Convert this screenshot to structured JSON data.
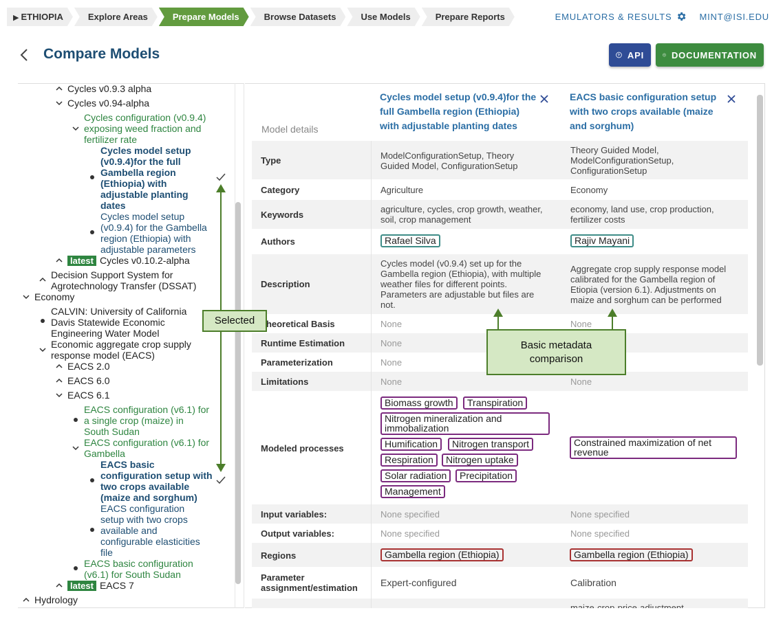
{
  "breadcrumb": {
    "items": [
      {
        "label": "ETHIOPIA",
        "active": false
      },
      {
        "label": "Explore Areas",
        "active": false
      },
      {
        "label": "Prepare Models",
        "active": true
      },
      {
        "label": "Browse Datasets",
        "active": false
      },
      {
        "label": "Use Models",
        "active": false
      },
      {
        "label": "Prepare Reports",
        "active": false
      }
    ]
  },
  "header": {
    "emulators_link": "EMULATORS & RESULTS",
    "user_link": "MINT@ISI.EDU"
  },
  "page": {
    "title": "Compare Models",
    "api_button": "API",
    "docs_button": "DOCUMENTATION"
  },
  "tree": {
    "cycles_093": "Cycles v0.9.3 alpha",
    "cycles_094": "Cycles v0.94-alpha",
    "cycles_cfg": "Cycles configuration (v0.9.4) exposing weed fraction and fertilizer rate",
    "cycles_setup_sel_l1": "Cycles model setup",
    "cycles_setup_sel_l2": "(v0.9.4)for the full",
    "cycles_setup_sel_l3": "Gambella region",
    "cycles_setup_sel_l4": "(Ethiopia) with",
    "cycles_setup_sel_l5": "adjustable planting",
    "cycles_setup_sel_l6": "dates",
    "cycles_setup2_l1": "Cycles model setup",
    "cycles_setup2_l2": "(v0.9.4) for the Gambella",
    "cycles_setup2_l3": "region (Ethiopia) with",
    "cycles_setup2_l4": "adjustable parameters",
    "latest_badge": "latest",
    "cycles_0102": "Cycles v0.10.2-alpha",
    "dssat_l1": "Decision Support System for",
    "dssat_l2": "Agrotechnology Transfer (DSSAT)",
    "economy": "Economy",
    "calvin_l1": "CALVIN: University of California",
    "calvin_l2": "Davis Statewide Economic",
    "calvin_l3": "Engineering Water Model",
    "eacs_l1": "Economic aggregate crop supply",
    "eacs_l2": "response model (EACS)",
    "eacs20": "EACS 2.0",
    "eacs60": "EACS 6.0",
    "eacs61": "EACS 6.1",
    "eacs_cfg_maize_l1": "EACS configuration (v6.1) for",
    "eacs_cfg_maize_l2": "a single crop (maize) in",
    "eacs_cfg_maize_l3": "South Sudan",
    "eacs_cfg_gam_l1": "EACS configuration (v6.1) for",
    "eacs_cfg_gam_l2": "Gambella",
    "eacs_sel_l1": "EACS basic",
    "eacs_sel_l2": "configuration setup with",
    "eacs_sel_l3": "two crops available",
    "eacs_sel_l4": "(maize and sorghum)",
    "eacs_el_l1": "EACS configuration",
    "eacs_el_l2": "setup with two crops",
    "eacs_el_l3": "available and",
    "eacs_el_l4": "configurable elasticities",
    "eacs_el_l5": "file",
    "eacs_basic_ss_l1": "EACS basic configuration",
    "eacs_basic_ss_l2": "(v6.1) for South Sudan",
    "eacs7": "EACS 7",
    "hydrology": "Hydrology"
  },
  "annotations": {
    "selected": "Selected",
    "metadata": "Basic metadata comparison"
  },
  "table": {
    "model_details_label": "Model details",
    "col1_title_l1": "Cycles model setup (v0.9.4)for the",
    "col1_title_l2": "full Gambella region (Ethiopia)",
    "col1_title_l3": "with adjustable planting dates",
    "col2_title_l1": "EACS basic configuration setup",
    "col2_title_l2": "with two crops available (maize",
    "col2_title_l3": "and sorghum)",
    "rows": {
      "type": {
        "label": "Type",
        "c1_l1": "ModelConfigurationSetup, Theory",
        "c1_l2": "Guided Model, ConfigurationSetup",
        "c2_l1": "Theory Guided Model,",
        "c2_l2": "ModelConfigurationSetup,",
        "c2_l3": "ConfigurationSetup"
      },
      "category": {
        "label": "Category",
        "c1": "Agriculture",
        "c2": "Economy"
      },
      "keywords": {
        "label": "Keywords",
        "c1_l1": "agriculture, cycles, crop growth, weather,",
        "c1_l2": "soil, crop management",
        "c2_l1": "economy, land use, crop production,",
        "c2_l2": "fertilizer costs"
      },
      "authors": {
        "label": "Authors",
        "c1": "Rafael Silva",
        "c2": "Rajiv Mayani"
      },
      "description": {
        "label": "Description",
        "c1_l1": "Cycles model (v0.9.4) set up for the",
        "c1_l2": "Gambella region (Ethiopia), with multiple",
        "c1_l3": "weather files for different points.",
        "c1_l4": "Parameters are adjustable but files are",
        "c1_l5": "not.",
        "c2_l1": "Aggregate crop supply response model",
        "c2_l2": "calibrated for the Gambella region of",
        "c2_l3": "Etiopia (version 6.1). Adjustments on",
        "c2_l4": "maize and sorghum can be performed"
      },
      "theoretical": {
        "label": "Theoretical Basis",
        "c1": "None",
        "c2": "None"
      },
      "runtime": {
        "label": "Runtime Estimation",
        "c1": "None"
      },
      "parameterization": {
        "label": "Parameterization",
        "c1": "None"
      },
      "limitations": {
        "label": "Limitations",
        "c1": "None",
        "c2": "None"
      },
      "processes": {
        "label": "Modeled processes",
        "c1": [
          "Biomass growth",
          "Transpiration",
          "Nitrogen mineralization and immobalization",
          "Humification",
          "Nitrogen transport",
          "Respiration",
          "Nitrogen uptake",
          "Solar radiation",
          "Precipitation",
          "Management"
        ],
        "c2": "Constrained maximization of net revenue"
      },
      "inputs": {
        "label": "Input variables:",
        "c1": "None specified",
        "c2": "None specified"
      },
      "outputs": {
        "label": "Output variables:",
        "c1": "None specified",
        "c2": "None specified"
      },
      "regions": {
        "label": "Regions",
        "c1": "Gambella region (Ethiopia)",
        "c2": "Gambella region (Ethiopia)"
      },
      "param_assign": {
        "label_l1": "Parameter",
        "label_l2": "assignment/estimation",
        "c1": "Expert-configured",
        "c2": "Calibration"
      },
      "cutoff": {
        "c2": "maize-crop-price-adjustment"
      }
    }
  },
  "colors": {
    "active_crumb": "#629b3f",
    "api": "#2f4c96",
    "docs": "#3d8c3f",
    "link": "#2b6ea5",
    "title": "#1e4e73",
    "annotation_fill": "#d5e8c4",
    "annotation_stroke": "#4c7e2a"
  }
}
